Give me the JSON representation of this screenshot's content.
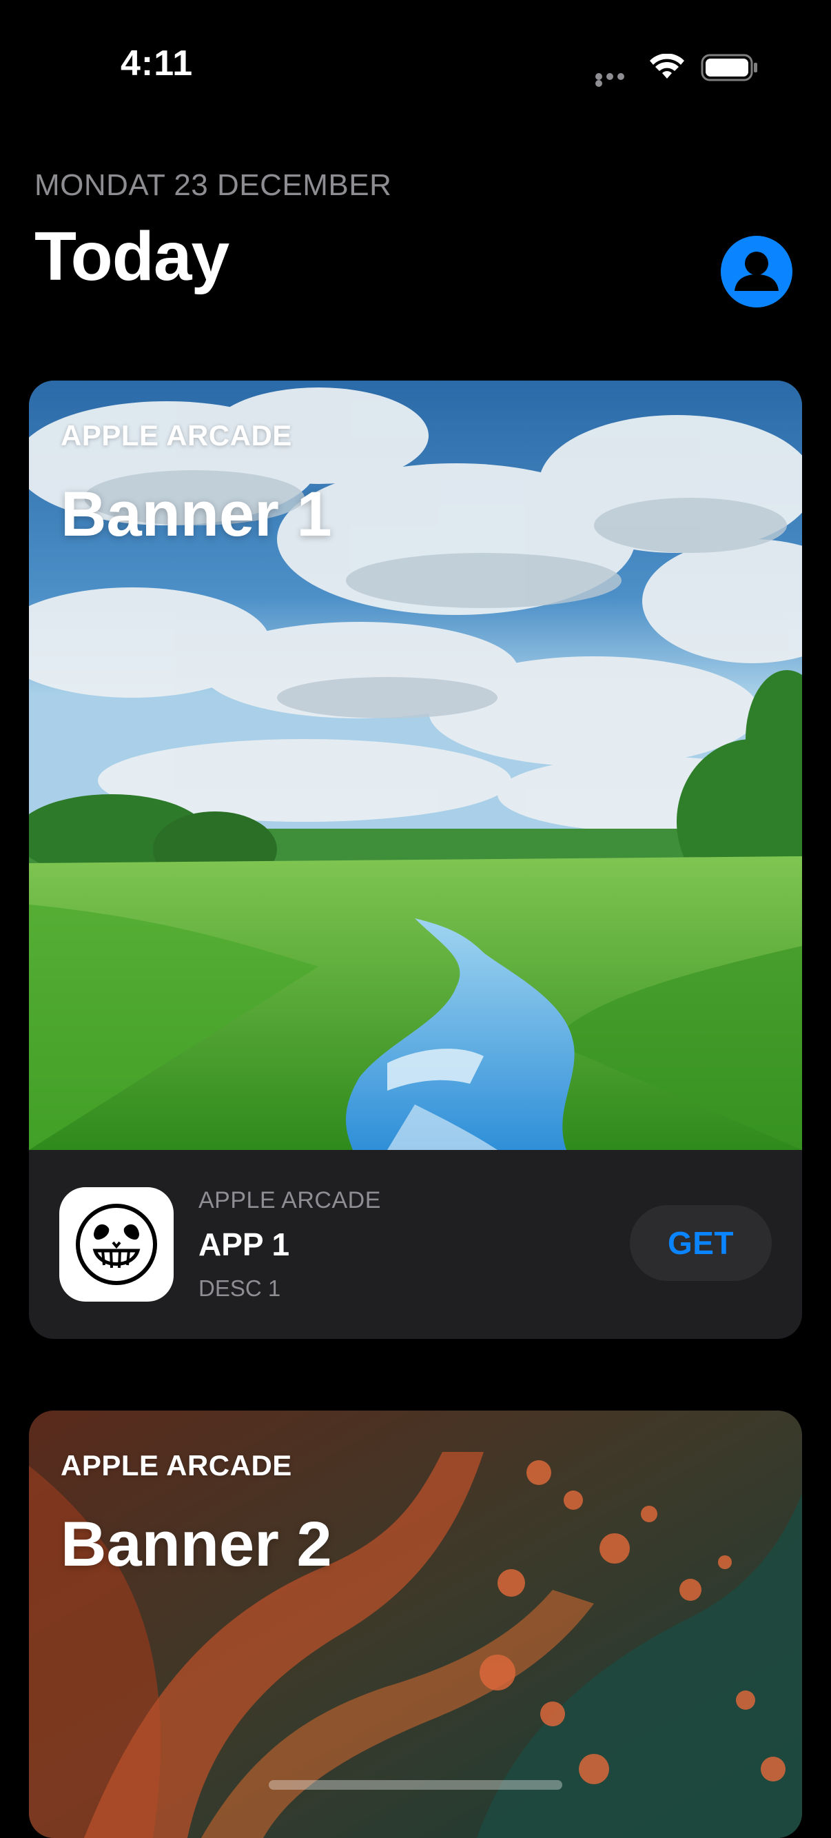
{
  "status_bar": {
    "time": "4:11"
  },
  "header": {
    "date": "MONDAT 23 DECEMBER",
    "title": "Today"
  },
  "cards": [
    {
      "eyebrow": "APPLE ARCADE",
      "title": "Banner 1",
      "image": "meadow-stream-landscape",
      "app": {
        "eyebrow": "APPLE ARCADE",
        "name": "APP 1",
        "description": "DESC 1",
        "icon": "skull-icon",
        "button_label": "GET"
      }
    },
    {
      "eyebrow": "APPLE ARCADE",
      "title": "Banner 2",
      "image": "red-green-abstract-landscape"
    }
  ],
  "colors": {
    "accent": "#0a84ff",
    "background": "#000000",
    "card_bottom": "#1f1f21",
    "secondary_text": "#8e8e93"
  }
}
